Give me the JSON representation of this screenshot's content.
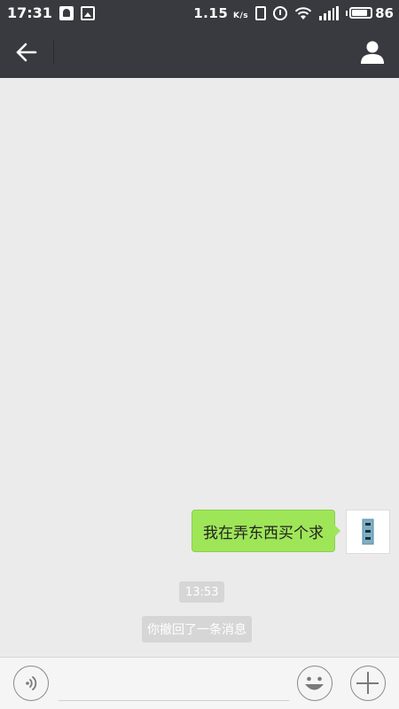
{
  "status_bar": {
    "time": "17:31",
    "network_speed": "1.15",
    "network_unit": "K/s",
    "battery_level": "86",
    "battery_fraction": 0.86
  },
  "header": {
    "icons": {
      "back": "back-arrow-icon",
      "contact": "person-icon"
    }
  },
  "chat": {
    "messages": [
      {
        "sender": "self",
        "text": "我在弄东西买个求"
      }
    ],
    "timestamp": "13:53",
    "system_notice": "你撤回了一条消息"
  },
  "input_bar": {
    "text_value": "",
    "placeholder": "",
    "icons": {
      "voice": "voice-icon",
      "emoji": "emoji-icon",
      "more": "plus-icon"
    }
  },
  "colors": {
    "header_bg": "#393a3f",
    "chat_bg": "#ebebeb",
    "bubble_self": "#9ee658",
    "notice_bg": "#d6d6d6"
  }
}
